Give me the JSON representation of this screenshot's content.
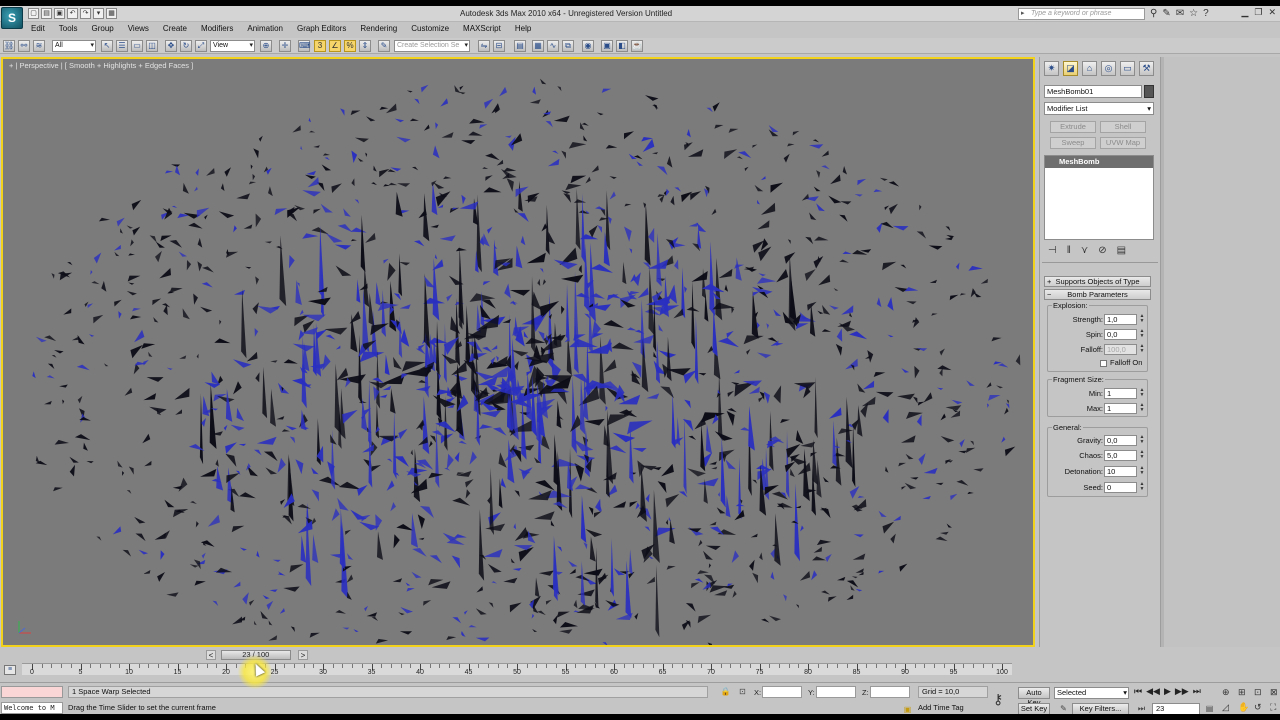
{
  "app": {
    "title": "Autodesk 3ds Max  2010 x64   -  Unregistered Version    Untitled",
    "logo_text": "S",
    "search_placeholder": "Type a keyword or phrase"
  },
  "menu": [
    "Edit",
    "Tools",
    "Group",
    "Views",
    "Create",
    "Modifiers",
    "Animation",
    "Graph Editors",
    "Rendering",
    "Customize",
    "MAXScript",
    "Help"
  ],
  "toolbar": {
    "selection_filter": "All",
    "reference_coord": "View",
    "named_selection_placeholder": "Create Selection Se"
  },
  "viewport": {
    "label": "+ | Perspective | [ Smooth + Highlights + Edged Faces ]"
  },
  "command_panel": {
    "object_name": "MeshBomb01",
    "modifier_list": "Modifier List",
    "modifier_buttons": [
      "Extrude",
      "Shell",
      "Sweep",
      "UVW Map"
    ],
    "stack_items": [
      "MeshBomb"
    ],
    "rollouts": {
      "supports": "Supports Objects of Type",
      "bomb_params": "Bomb Parameters"
    },
    "explosion": {
      "title": "Explosion:",
      "strength_label": "Strength:",
      "strength": "1,0",
      "spin_label": "Spin:",
      "spin": "0,0",
      "falloff_label": "Falloff:",
      "falloff": "100,0",
      "falloff_on": "Falloff On"
    },
    "fragment": {
      "title": "Fragment Size:",
      "min_label": "Min:",
      "min": "1",
      "max_label": "Max:",
      "max": "1"
    },
    "general": {
      "title": "General:",
      "gravity_label": "Gravity:",
      "gravity": "0,0",
      "chaos_label": "Chaos:",
      "chaos": "5,0",
      "detonation_label": "Detonation:",
      "detonation": "10",
      "seed_label": "Seed:",
      "seed": "0"
    }
  },
  "timeline": {
    "slider_text": "23 / 100",
    "current_frame": 23,
    "total_frames": 100,
    "tick_labels": [
      "0",
      "5",
      "10",
      "15",
      "20",
      "25",
      "30",
      "35",
      "40",
      "45",
      "50",
      "55",
      "60",
      "65",
      "70",
      "75",
      "80",
      "85",
      "90",
      "95",
      "100"
    ]
  },
  "status": {
    "selection": "1 Space Warp Selected",
    "prompt": "Drag the Time Slider to set the current frame",
    "maxscript": "Welcome to M",
    "x_label": "X:",
    "y_label": "Y:",
    "z_label": "Z:",
    "grid": "Grid = 10,0",
    "add_time_tag": "Add Time Tag",
    "auto_key": "Auto Key",
    "set_key": "Set Key",
    "key_mode": "Selected",
    "key_filters": "Key Filters...",
    "frame": "23"
  },
  "colors": {
    "viewport_bg": "#7b7b7b",
    "active_border": "#f2d21b",
    "fragment_blue": "#2a2fc0",
    "fragment_dark": "#0d0d18"
  }
}
